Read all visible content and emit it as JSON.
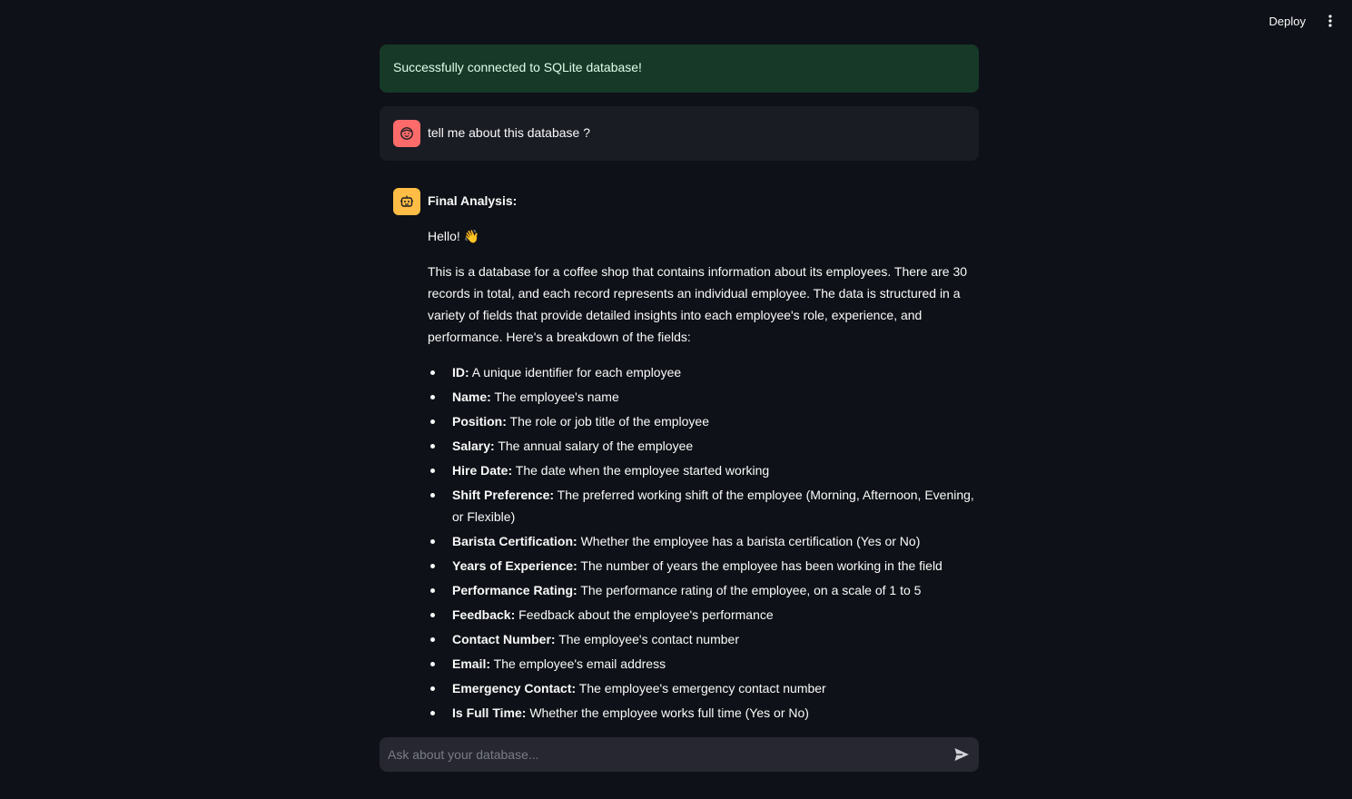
{
  "header": {
    "deploy_label": "Deploy",
    "menu_icon": "vertical-ellipsis-icon"
  },
  "alert": {
    "text": "Successfully connected to SQLite database!",
    "color": "#173928"
  },
  "user_message": {
    "avatar_icon": "smiley-face-icon",
    "avatar_color": "#ff6b6b",
    "text": "tell me about this database ?"
  },
  "assistant_message": {
    "avatar_icon": "robot-icon",
    "avatar_color": "#ffbd45",
    "title": "Final Analysis:",
    "greeting": "Hello! 👋",
    "paragraph": "This is a database for a coffee shop that contains information about its employees. There are 30 records in total, and each record represents an individual employee. The data is structured in a variety of fields that provide detailed insights into each employee's role, experience, and performance. Here's a breakdown of the fields:",
    "fields": [
      {
        "name": "ID:",
        "desc": " A unique identifier for each employee"
      },
      {
        "name": "Name:",
        "desc": " The employee's name"
      },
      {
        "name": "Position:",
        "desc": " The role or job title of the employee"
      },
      {
        "name": "Salary:",
        "desc": " The annual salary of the employee"
      },
      {
        "name": "Hire Date:",
        "desc": " The date when the employee started working"
      },
      {
        "name": "Shift Preference:",
        "desc": " The preferred working shift of the employee (Morning, Afternoon, Evening, or Flexible)"
      },
      {
        "name": "Barista Certification:",
        "desc": " Whether the employee has a barista certification (Yes or No)"
      },
      {
        "name": "Years of Experience:",
        "desc": " The number of years the employee has been working in the field"
      },
      {
        "name": "Performance Rating:",
        "desc": " The performance rating of the employee, on a scale of 1 to 5"
      },
      {
        "name": "Feedback:",
        "desc": " Feedback about the employee's performance"
      },
      {
        "name": "Contact Number:",
        "desc": " The employee's contact number"
      },
      {
        "name": "Email:",
        "desc": " The employee's email address"
      },
      {
        "name": "Emergency Contact:",
        "desc": " The employee's emergency contact number"
      },
      {
        "name": "Is Full Time:",
        "desc": " Whether the employee works full time (Yes or No)"
      }
    ]
  },
  "chat_input": {
    "placeholder": "Ask about your database...",
    "value": "",
    "send_icon": "send-arrow-icon"
  }
}
